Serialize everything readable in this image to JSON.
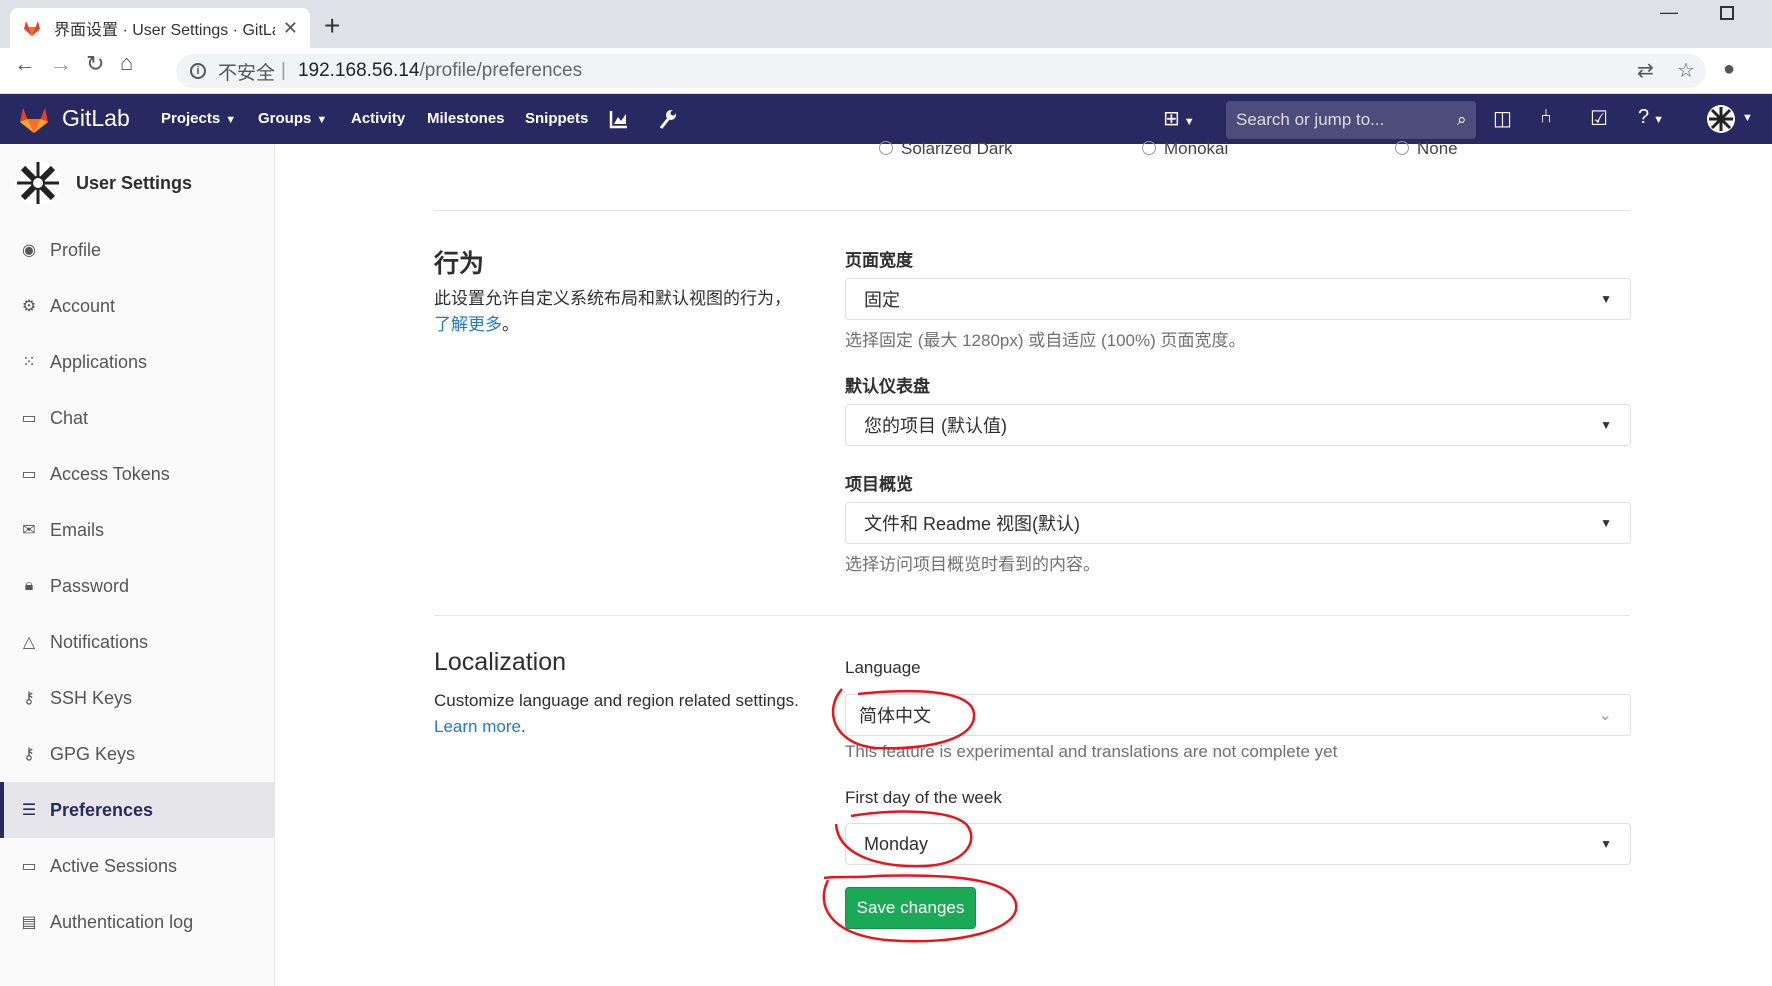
{
  "browser": {
    "tab_title": "界面设置 · User Settings · GitLab",
    "url_insecure": "不安全",
    "url_separator": "|",
    "url_host": "192.168.56.14",
    "url_path": "/profile/preferences"
  },
  "navbar": {
    "brand": "GitLab",
    "items": [
      {
        "label": "Projects",
        "dropdown": true
      },
      {
        "label": "Groups",
        "dropdown": true
      },
      {
        "label": "Activity"
      },
      {
        "label": "Milestones"
      },
      {
        "label": "Snippets"
      }
    ],
    "search_placeholder": "Search or jump to...",
    "brand_color": "#292961"
  },
  "sidebar": {
    "title": "User Settings",
    "items": [
      {
        "label": "Profile",
        "icon": "profile-icon"
      },
      {
        "label": "Account",
        "icon": "account-icon"
      },
      {
        "label": "Applications",
        "icon": "applications-icon"
      },
      {
        "label": "Chat",
        "icon": "chat-icon"
      },
      {
        "label": "Access Tokens",
        "icon": "token-icon"
      },
      {
        "label": "Emails",
        "icon": "mail-icon"
      },
      {
        "label": "Password",
        "icon": "lock-icon"
      },
      {
        "label": "Notifications",
        "icon": "bell-icon"
      },
      {
        "label": "SSH Keys",
        "icon": "key-icon"
      },
      {
        "label": "GPG Keys",
        "icon": "key-icon"
      },
      {
        "label": "Preferences",
        "icon": "sliders-icon",
        "active": true
      },
      {
        "label": "Active Sessions",
        "icon": "monitor-icon"
      },
      {
        "label": "Authentication log",
        "icon": "log-icon"
      }
    ]
  },
  "themes": {
    "options": [
      "Solarized Dark",
      "Monokai",
      "None"
    ]
  },
  "behavior": {
    "title": "行为",
    "description": "此设置允许自定义系统布局和默认视图的行为，",
    "learn_more": "了解更多",
    "learn_more_suffix": "。",
    "layout_width_label": "页面宽度",
    "layout_width_value": "固定",
    "layout_width_help": "选择固定 (最大 1280px) 或自适应 (100%) 页面宽度。",
    "dashboard_label": "默认仪表盘",
    "dashboard_value": "您的项目 (默认值)",
    "project_view_label": "项目概览",
    "project_view_value": "文件和 Readme 视图(默认)",
    "project_view_help": "选择访问项目概览时看到的内容。"
  },
  "localization": {
    "title": "Localization",
    "description": "Customize language and region related settings.",
    "learn_more": "Learn more",
    "learn_more_suffix": ".",
    "language_label": "Language",
    "language_value": "简体中文",
    "language_help": "This feature is experimental and translations are not complete yet",
    "first_day_label": "First day of the week",
    "first_day_value": "Monday"
  },
  "actions": {
    "save_label": "Save changes",
    "save_color": "#1aaa55"
  },
  "annotation_color": "#e8161b"
}
